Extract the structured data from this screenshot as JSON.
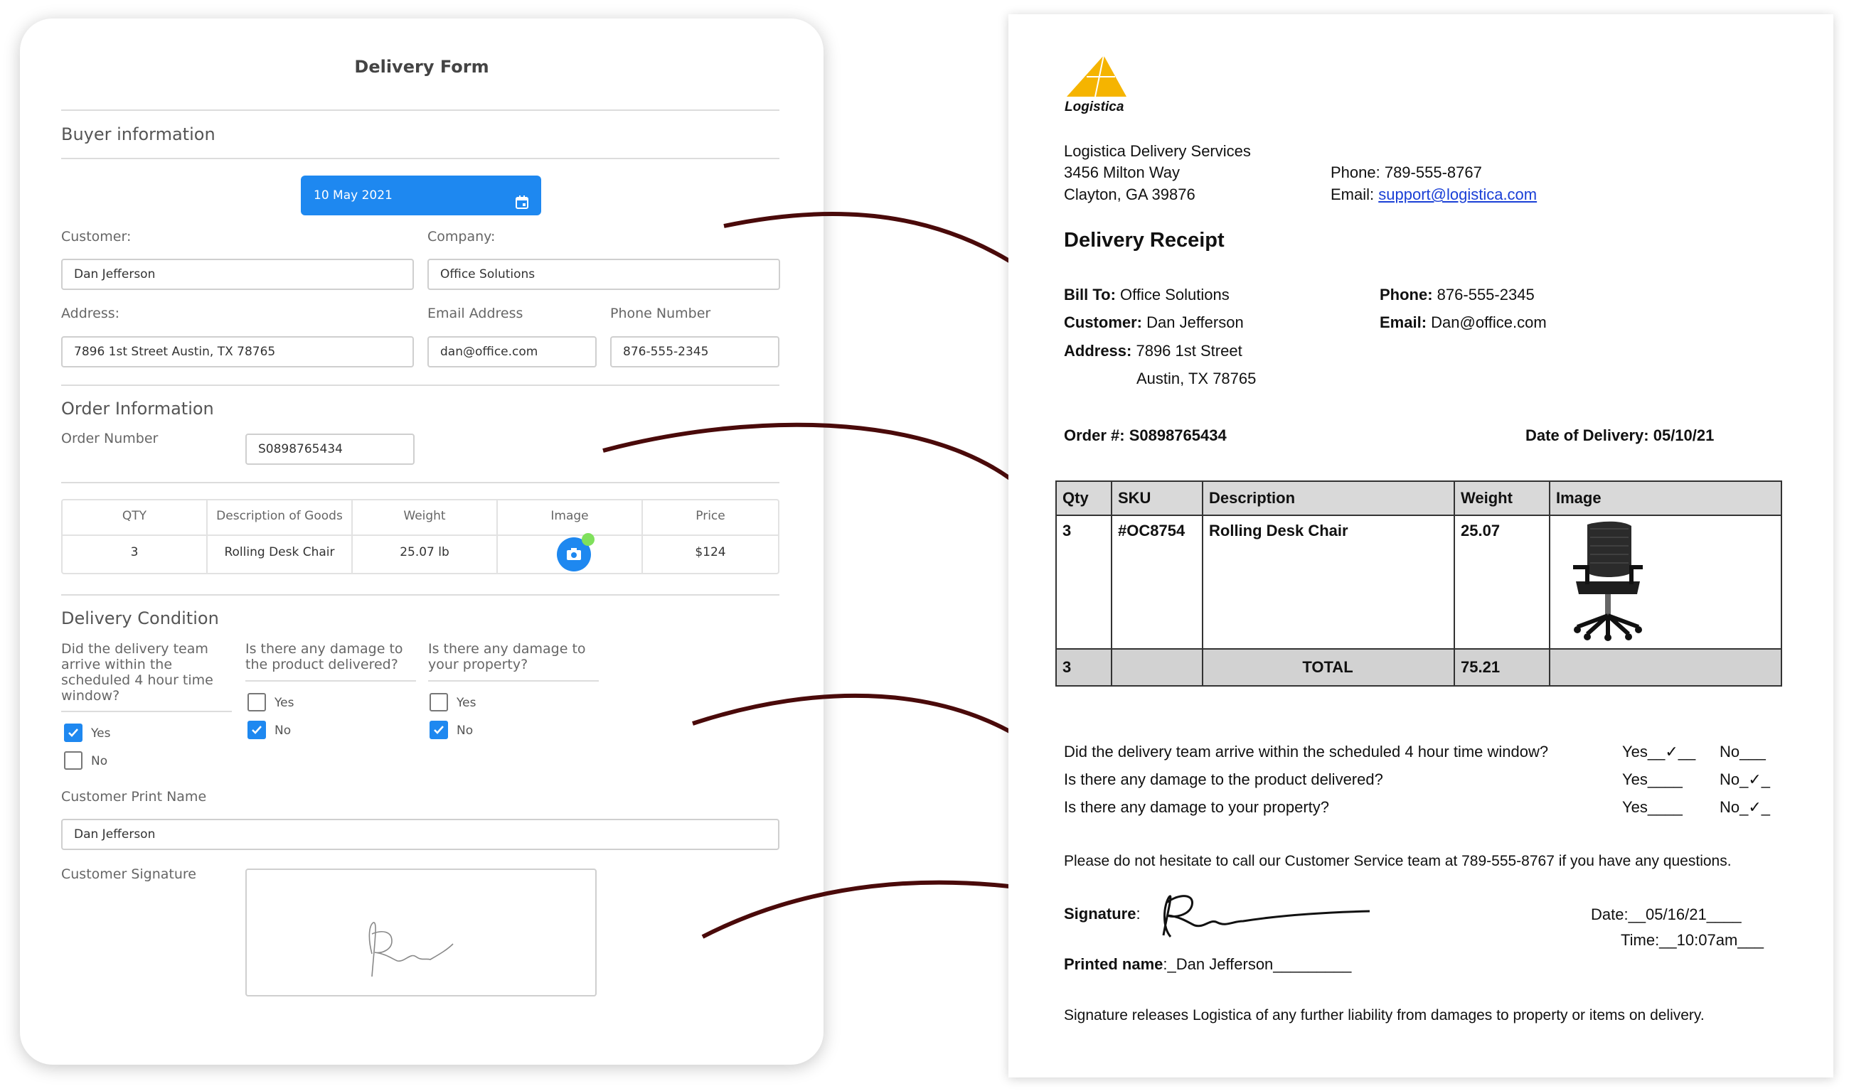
{
  "form": {
    "title": "Delivery Form",
    "buyer_section": "Buyer information",
    "date": "10 May 2021",
    "customer_label": "Customer:",
    "customer_value": "Dan Jefferson",
    "company_label": "Company:",
    "company_value": "Office Solutions",
    "address_label": "Address:",
    "address_value": "7896 1st Street Austin, TX 78765",
    "email_label": "Email Address",
    "email_value": "dan@office.com",
    "phone_label": "Phone Number",
    "phone_value": "876-555-2345",
    "order_section": "Order Information",
    "order_number_label": "Order Number",
    "order_number_value": "S0898765434",
    "table_headers": [
      "QTY",
      "Description of Goods",
      "Weight",
      "Image",
      "Price"
    ],
    "table_row": {
      "qty": "3",
      "description": "Rolling Desk Chair",
      "weight": "25.07 lb",
      "price": "$124"
    },
    "condition_section": "Delivery Condition",
    "q1": "Did the delivery team arrive within the scheduled 4 hour time window?",
    "q1_lines": [
      "Did the delivery team",
      "arrive within the",
      "scheduled 4 hour time",
      "window?"
    ],
    "q2_lines": [
      "Is there any damage to",
      "the product delivered?"
    ],
    "q3_lines": [
      "Is there any damage to",
      "your property?"
    ],
    "q1_yes": "Yes",
    "q1_no": "No",
    "q2_yes": "Yes",
    "q2_no": "No",
    "q3_yes": "Yes",
    "q3_no": "No",
    "q1_answer": "Yes",
    "q2_answer": "No",
    "q3_answer": "No",
    "print_name_label": "Customer Print Name",
    "print_name_value": "Dan Jefferson",
    "signature_label": "Customer Signature",
    "accent_color": "#1e88f0"
  },
  "receipt": {
    "logo_text": "Logistica",
    "company_name": "Logistica Delivery Services",
    "street": "3456 Milton Way",
    "city": "Clayton, GA 39876",
    "phone": "Phone: 789-555-8767",
    "email_label": "Email: ",
    "email": "support@logistica.com",
    "title": "Delivery Receipt",
    "bill_to_label": "Bill To:",
    "bill_to": " Office Solutions",
    "customer_label": "Customer:",
    "customer": " Dan Jefferson",
    "address_label": "Address:",
    "address_line1": " 7896 1st Street",
    "address_line2": "Austin, TX 78765",
    "phone_label": "Phone:",
    "phone_value": " 876-555-2345",
    "email2_label": "Email:",
    "email2_value": " Dan@office.com",
    "order_label": "Order #: S0898765434",
    "delivery_date": "Date of Delivery: 05/10/21",
    "table_headers": [
      "Qty",
      "SKU",
      "Description",
      "Weight",
      "Image"
    ],
    "table_row": {
      "qty": "3",
      "sku": "#OC8754",
      "description": "Rolling Desk Chair",
      "weight": "25.07"
    },
    "table_total": {
      "qty": "3",
      "label": "TOTAL",
      "weight": "75.21"
    },
    "q1": "Did the delivery team arrive within the scheduled 4 hour time window?",
    "q2": "Is there any damage to the product delivered?",
    "q3": "Is there any damage to your property?",
    "q1_yes": "Yes__✓__",
    "q1_no": "No___",
    "q2_yes": "Yes____",
    "q2_no": "No_✓_",
    "q3_yes": "Yes____",
    "q3_no": "No_✓_",
    "contact_note": "Please do not hesitate to call our Customer Service team at 789-555-8767 if you have any questions.",
    "signature_label": "Signature",
    "signature_colon": ":",
    "date_line": "Date:__05/16/21____",
    "time_line": "Time:__10:07am___",
    "printed_name_label": "Printed name",
    "printed_name_value": ":_Dan Jefferson_________",
    "liability_note": "Signature releases Logistica of any further liability from damages to property or items on delivery.",
    "logo_color": "#f5b400",
    "arrow_color": "#4a0a0a"
  }
}
